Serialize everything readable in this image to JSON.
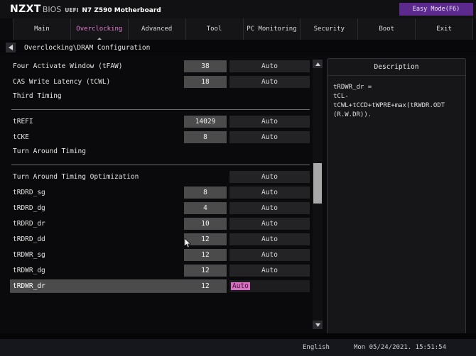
{
  "header": {
    "brand": "NZXT",
    "bios_label": "BIOS",
    "uefi_label": "UEFI",
    "motherboard": "N7 Z590 Motherboard",
    "easy_mode_label": "Easy Mode(F6)",
    "easy_mode_color": "#5c2a8c"
  },
  "tabs": [
    {
      "label": "Main",
      "active": false
    },
    {
      "label": "Overclocking",
      "active": true
    },
    {
      "label": "Advanced",
      "active": false
    },
    {
      "label": "Tool",
      "active": false
    },
    {
      "label": "PC Monitoring",
      "active": false
    },
    {
      "label": "Security",
      "active": false
    },
    {
      "label": "Boot",
      "active": false
    },
    {
      "label": "Exit",
      "active": false
    }
  ],
  "breadcrumb": {
    "back_icon": "back-arrow-icon",
    "path": "Overclocking\\DRAM Configuration"
  },
  "accent": {
    "active_tab": "#e07fd0",
    "highlight": "#d871c4",
    "value_box": "#4b4b4b",
    "auto_box": "#232326"
  },
  "rows": [
    {
      "type": "setting",
      "label": "Four Activate Window (tFAW)",
      "value": "38",
      "auto": "Auto",
      "selected": false
    },
    {
      "type": "setting",
      "label": "CAS Write Latency (tCWL)",
      "value": "18",
      "auto": "Auto",
      "selected": false
    },
    {
      "type": "section",
      "label": "Third Timing"
    },
    {
      "type": "setting",
      "label": "tREFI",
      "value": "14029",
      "auto": "Auto",
      "selected": false
    },
    {
      "type": "setting",
      "label": "tCKE",
      "value": "8",
      "auto": "Auto",
      "selected": false
    },
    {
      "type": "section",
      "label": "Turn Around Timing"
    },
    {
      "type": "setting",
      "label": "Turn Around Timing Optimization",
      "value": "",
      "auto": "Auto",
      "selected": false
    },
    {
      "type": "setting",
      "label": "tRDRD_sg",
      "value": "8",
      "auto": "Auto",
      "selected": false
    },
    {
      "type": "setting",
      "label": "tRDRD_dg",
      "value": "4",
      "auto": "Auto",
      "selected": false
    },
    {
      "type": "setting",
      "label": "tRDRD_dr",
      "value": "10",
      "auto": "Auto",
      "selected": false
    },
    {
      "type": "setting",
      "label": "tRDRD_dd",
      "value": "12",
      "auto": "Auto",
      "selected": false
    },
    {
      "type": "setting",
      "label": "tRDWR_sg",
      "value": "12",
      "auto": "Auto",
      "selected": false
    },
    {
      "type": "setting",
      "label": "tRDWR_dg",
      "value": "12",
      "auto": "Auto",
      "selected": false
    },
    {
      "type": "setting",
      "label": "tRDWR_dr",
      "value": "12",
      "auto": "Auto",
      "selected": true
    }
  ],
  "scrollbar": {
    "up_icon": "chevron-up-icon",
    "down_icon": "chevron-down-icon"
  },
  "description": {
    "title": "Description",
    "text": "tRDWR_dr =\ntCL-tCWL+tCCD+tWPRE+max(tRWDR.ODT (R.W.DR))."
  },
  "footer": {
    "language": "English",
    "datetime": "Mon 05/24/2021. 15:51:54"
  }
}
